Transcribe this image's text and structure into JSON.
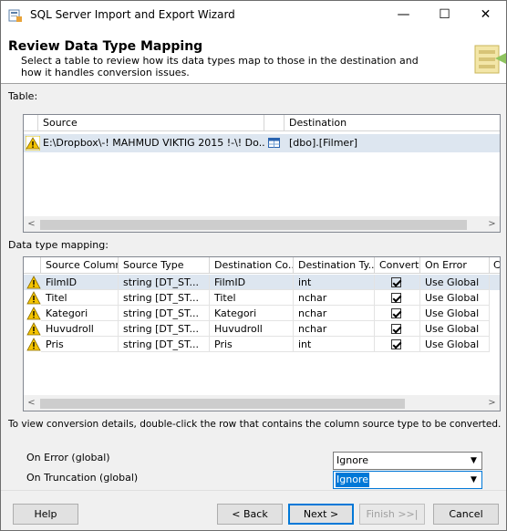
{
  "window": {
    "title": "SQL Server Import and Export Wizard",
    "minimize": "—",
    "maximize": "☐",
    "close": "✕"
  },
  "header": {
    "title": "Review Data Type Mapping",
    "subtitle": "Select a table to review how its data types map to those in the destination and how it handles conversion issues."
  },
  "table_section": {
    "label": "Table:",
    "columns": [
      "Source",
      "Destination"
    ],
    "rows": [
      {
        "source": "E:\\Dropbox\\-! MAHMUD VIKTIG 2015 !-\\! Do...",
        "destination": "[dbo].[Filmer]"
      }
    ]
  },
  "mapping_section": {
    "label": "Data type mapping:",
    "columns": [
      "Source Column",
      "Source Type",
      "Destination Co...",
      "Destination Ty...",
      "Convert",
      "On Error",
      "C"
    ],
    "rows": [
      {
        "source_column": "FilmID",
        "source_type": "string [DT_ST...",
        "dest_column": "FilmID",
        "dest_type": "int",
        "convert": true,
        "on_error": "Use Global"
      },
      {
        "source_column": "Titel",
        "source_type": "string [DT_ST...",
        "dest_column": "Titel",
        "dest_type": "nchar",
        "convert": true,
        "on_error": "Use Global"
      },
      {
        "source_column": "Kategori",
        "source_type": "string [DT_ST...",
        "dest_column": "Kategori",
        "dest_type": "nchar",
        "convert": true,
        "on_error": "Use Global"
      },
      {
        "source_column": "Huvudroll",
        "source_type": "string [DT_ST...",
        "dest_column": "Huvudroll",
        "dest_type": "nchar",
        "convert": true,
        "on_error": "Use Global"
      },
      {
        "source_column": "Pris",
        "source_type": "string [DT_ST...",
        "dest_column": "Pris",
        "dest_type": "int",
        "convert": true,
        "on_error": "Use Global"
      }
    ]
  },
  "hint": "To view conversion details, double-click the row that contains the column source type to be converted.",
  "global": {
    "on_error_label": "On Error (global)",
    "on_error_value": "Ignore",
    "on_truncation_label": "On Truncation (global)",
    "on_truncation_value": "Ignore"
  },
  "buttons": {
    "help": "Help",
    "back": "< Back",
    "next": "Next >",
    "finish": "Finish >>|",
    "cancel": "Cancel"
  },
  "scroll_arrows": {
    "left": "<",
    "right": ">"
  },
  "icons": {
    "warning": "warning-icon",
    "table": "table-icon",
    "app": "wizard-app-icon",
    "header_art": "wizard-header-art"
  },
  "colors": {
    "selection": "#0078d7",
    "row_highlight": "#dde6f0",
    "warning_yellow": "#f5c400"
  }
}
